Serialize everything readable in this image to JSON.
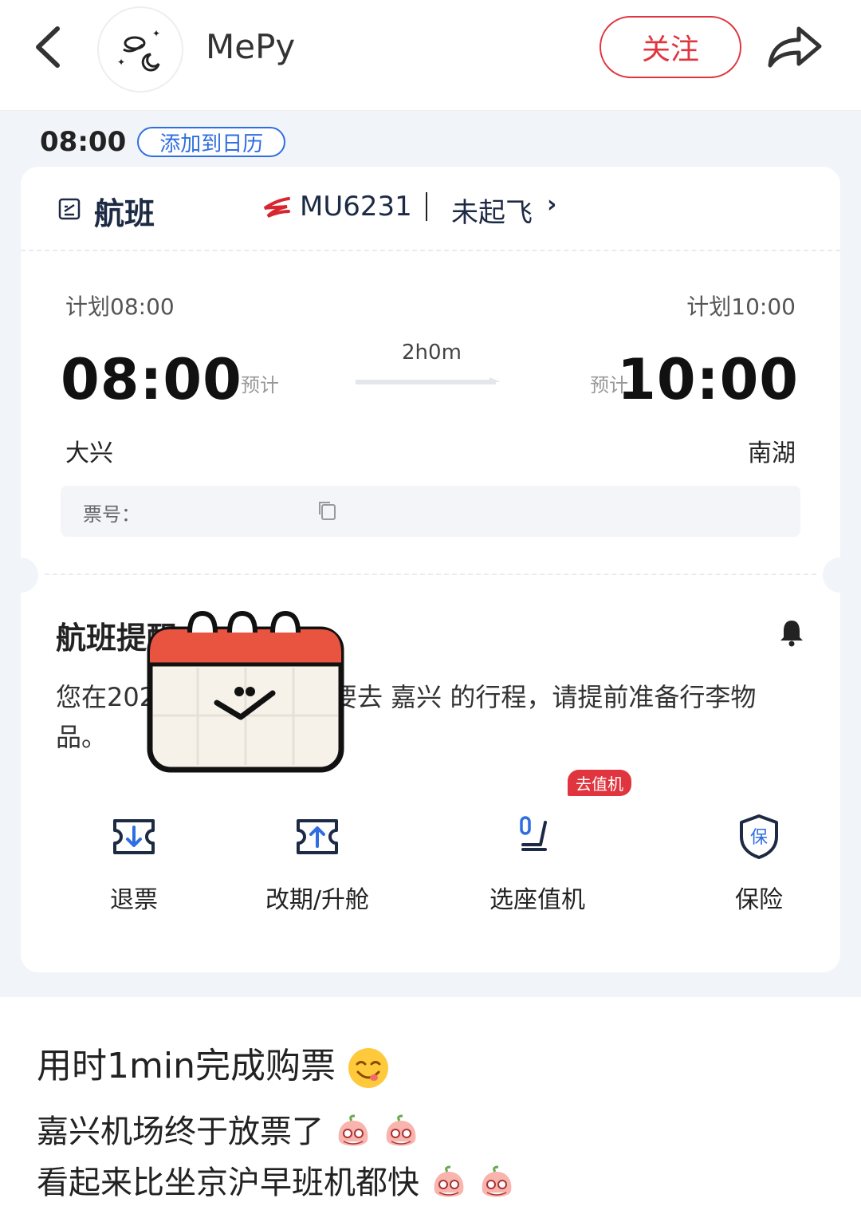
{
  "header": {
    "author_name": "MePy",
    "follow_label": "关注"
  },
  "calendar": {
    "time": "08:00",
    "add_label": "添加到日历"
  },
  "flight": {
    "section_title": "航班",
    "flight_number": "MU6231",
    "status": "未起飞",
    "status_arrow": "›",
    "planned_departure": "计划08:00",
    "planned_arrival": "计划10:00",
    "departure_time": "08:00",
    "arrival_time": "10:00",
    "estimated_tag": "预计",
    "duration": "2h0m",
    "departure_airport": "大兴",
    "arrival_airport": "南湖",
    "ticket_label": "票号："
  },
  "reminder": {
    "title": "航班提醒",
    "text": "您在2026-01-14有一段要去 嘉兴 的行程，请提前准备行李物品。"
  },
  "actions": [
    {
      "label": "退票",
      "icon": "refund-ticket-icon"
    },
    {
      "label": "改期/升舱",
      "icon": "change-ticket-icon"
    },
    {
      "label": "选座值机",
      "icon": "seat-icon",
      "badge": "去值机"
    },
    {
      "label": "保险",
      "icon": "insurance-shield-icon"
    }
  ],
  "caption": {
    "title": "用时1min完成购票",
    "line1": "嘉兴机场终于放票了",
    "line2": "看起来比坐京沪早班机都快"
  },
  "colors": {
    "accent_red": "#e0353e",
    "accent_blue": "#2f6ee0",
    "panel_bg": "#f1f4f9"
  }
}
